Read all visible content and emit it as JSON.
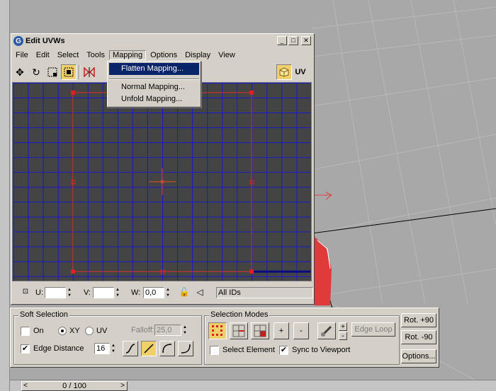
{
  "window": {
    "title": "Edit UVWs",
    "minimize": "_",
    "maximize": "□",
    "close": "✕"
  },
  "menu": [
    "File",
    "Edit",
    "Select",
    "Tools",
    "Mapping",
    "Options",
    "Display",
    "View"
  ],
  "toolbar": {
    "uv_label": "UV"
  },
  "mapping_menu": {
    "items": [
      "Flatten Mapping...",
      "Normal Mapping...",
      "Unfold Mapping..."
    ],
    "highlighted": "Flatten Mapping..."
  },
  "status": {
    "u_label": "U:",
    "u_value": "",
    "v_label": "V:",
    "v_value": "",
    "w_label": "W:",
    "w_value": "0,0",
    "id_filter": "All IDs"
  },
  "soft_selection": {
    "title": "Soft Selection",
    "on_label": "On",
    "on_checked": false,
    "xy_label": "XY",
    "xy_selected": true,
    "uv_label": "UV",
    "uv_selected": false,
    "falloff_label": "Falloff:",
    "falloff_value": "25,0",
    "edge_distance_label": "Edge Distance",
    "edge_distance_checked": true,
    "edge_distance_value": "16"
  },
  "selection_modes": {
    "title": "Selection Modes",
    "plus": "+",
    "minus": "-",
    "spin_plus": "+",
    "spin_minus": "-",
    "edge_loop": "Edge Loop",
    "select_element_label": "Select Element",
    "select_element_checked": false,
    "sync_label": "Sync to Viewport",
    "sync_checked": true
  },
  "rotate": {
    "plus90": "Rot. +90",
    "minus90": "Rot. -90",
    "options": "Options..."
  },
  "timeline": {
    "frame": "0 / 100",
    "prev": "<",
    "next": ">"
  },
  "check_mark": "✔",
  "colors": {
    "grid": "#1a1ac8",
    "editor_bg": "#444444",
    "uv_frame": "#e03030",
    "highlight": "#0a246a",
    "pressed": "#f0d068"
  }
}
